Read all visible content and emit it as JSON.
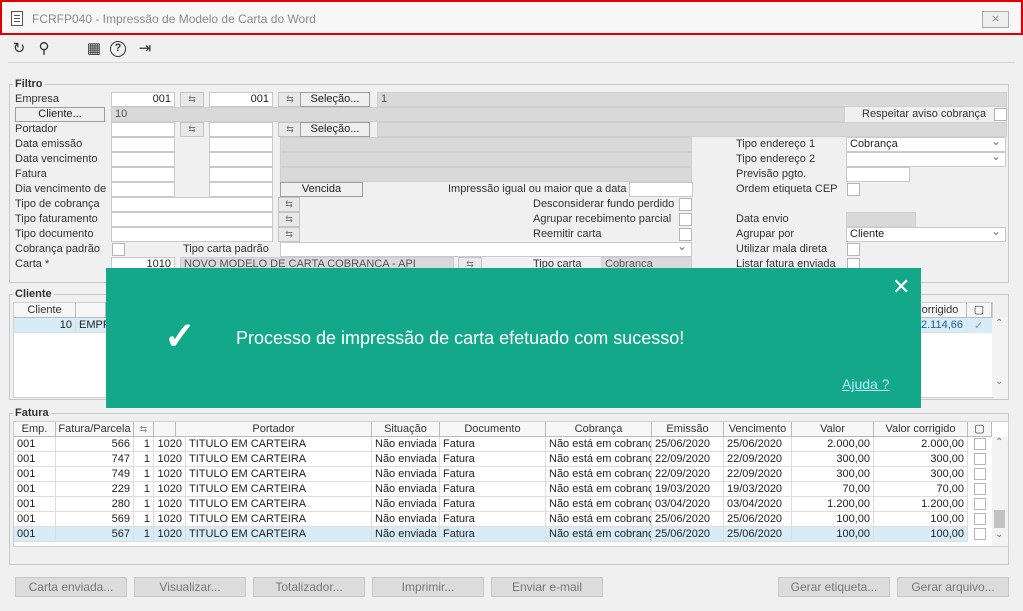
{
  "window": {
    "title": "FCRFP040 - Impressão de Modelo de Carta do Word",
    "close_glyph": "⨯"
  },
  "toolbar": {
    "refresh": "↻",
    "search": "⚲",
    "calendar": "▦",
    "help": "?",
    "exit": "⇥"
  },
  "filtro": {
    "legend": "Filtro",
    "empresa_label": "Empresa",
    "empresa_from": "001",
    "empresa_to": "001",
    "empresa_desc": "1",
    "selecao_label": "Seleção...",
    "cliente_btn": "Cliente...",
    "cliente_value": "10",
    "respeitar_label": "Respeitar aviso cobrança",
    "portador_label": "Portador",
    "data_emissao_label": "Data emissão",
    "data_vencimento_label": "Data vencimento",
    "fatura_label": "Fatura",
    "dia_venc_label": "Dia vencimento de",
    "vencida_btn": "Vencida",
    "impressao_label": "Impressão igual ou maior que a data",
    "tipo_cobranca_label": "Tipo de cobrança",
    "tipo_faturamento_label": "Tipo faturamento",
    "tipo_documento_label": "Tipo documento",
    "cobranca_padrao_label": "Cobrança padrão",
    "tipo_carta_padrao_label": "Tipo carta padrão",
    "carta_label": "Carta *",
    "carta_code": "1010",
    "carta_desc": "NOVO MODELO DE CARTA COBRANCA - API",
    "tipo_carta_label": "Tipo carta",
    "tipo_carta_value": "Cobranca",
    "desconsiderar_label": "Desconsiderar fundo perdido",
    "agrupar_receb_label": "Agrupar recebimento parcial",
    "reemitir_label": "Reemitir carta",
    "tipo_end1_label": "Tipo endereço 1",
    "tipo_end1_value": "Cobrança",
    "tipo_end2_label": "Tipo endereço 2",
    "previsao_label": "Previsão pgto.",
    "ordem_etiqueta_label": "Ordem etiqueta CEP",
    "data_envio_label": "Data envio",
    "agrupar_por_label": "Agrupar por",
    "agrupar_por_value": "Cliente",
    "mala_direta_label": "Utilizar mala direta",
    "listar_fatura_label": "Listar fatura enviada"
  },
  "cliente_section": {
    "legend": "Cliente",
    "col_cliente": "Cliente",
    "col_corrigido": "orrigido",
    "row_code": "10",
    "row_name": "EMPR",
    "row_value": "2.114,66"
  },
  "fatura_section": {
    "legend": "Fatura",
    "columns": [
      "Emp.",
      "Fatura/Parcela",
      "",
      "",
      "Portador",
      "Situação",
      "Documento",
      "Cobrança",
      "Emissão",
      "Vencimento",
      "Valor",
      "Valor corrigido"
    ],
    "rows": [
      {
        "emp": "001",
        "fatura": "566",
        "parc": "1",
        "port_code": "1020",
        "portador": "TITULO EM CARTEIRA",
        "situacao": "Não enviada",
        "documento": "Fatura",
        "cobranca": "Não está em cobrança",
        "emissao": "25/06/2020",
        "vencimento": "25/06/2020",
        "valor": "2.000,00",
        "corrigido": "2.000,00"
      },
      {
        "emp": "001",
        "fatura": "747",
        "parc": "1",
        "port_code": "1020",
        "portador": "TITULO EM CARTEIRA",
        "situacao": "Não enviada",
        "documento": "Fatura",
        "cobranca": "Não está em cobrança",
        "emissao": "22/09/2020",
        "vencimento": "22/09/2020",
        "valor": "300,00",
        "corrigido": "300,00"
      },
      {
        "emp": "001",
        "fatura": "749",
        "parc": "1",
        "port_code": "1020",
        "portador": "TITULO EM CARTEIRA",
        "situacao": "Não enviada",
        "documento": "Fatura",
        "cobranca": "Não está em cobrança",
        "emissao": "22/09/2020",
        "vencimento": "22/09/2020",
        "valor": "300,00",
        "corrigido": "300,00"
      },
      {
        "emp": "001",
        "fatura": "229",
        "parc": "1",
        "port_code": "1020",
        "portador": "TITULO EM CARTEIRA",
        "situacao": "Não enviada",
        "documento": "Fatura",
        "cobranca": "Não está em cobrança",
        "emissao": "19/03/2020",
        "vencimento": "19/03/2020",
        "valor": "70,00",
        "corrigido": "70,00"
      },
      {
        "emp": "001",
        "fatura": "280",
        "parc": "1",
        "port_code": "1020",
        "portador": "TITULO EM CARTEIRA",
        "situacao": "Não enviada",
        "documento": "Fatura",
        "cobranca": "Não está em cobrança",
        "emissao": "03/04/2020",
        "vencimento": "03/04/2020",
        "valor": "1.200,00",
        "corrigido": "1.200,00"
      },
      {
        "emp": "001",
        "fatura": "569",
        "parc": "1",
        "port_code": "1020",
        "portador": "TITULO EM CARTEIRA",
        "situacao": "Não enviada",
        "documento": "Fatura",
        "cobranca": "Não está em cobrança",
        "emissao": "25/06/2020",
        "vencimento": "25/06/2020",
        "valor": "100,00",
        "corrigido": "100,00"
      },
      {
        "emp": "001",
        "fatura": "567",
        "parc": "1",
        "port_code": "1020",
        "portador": "TITULO EM CARTEIRA",
        "situacao": "Não enviada",
        "documento": "Fatura",
        "cobranca": "Não está em cobrança",
        "emissao": "25/06/2020",
        "vencimento": "25/06/2020",
        "valor": "100,00",
        "corrigido": "100,00"
      }
    ]
  },
  "buttons": {
    "carta_enviada": "Carta enviada...",
    "visualizar": "Visualizar...",
    "totalizador": "Totalizador...",
    "imprimir": "Imprimir...",
    "enviar_email": "Enviar e-mail",
    "gerar_etiqueta": "Gerar etiqueta...",
    "gerar_arquivo": "Gerar arquivo..."
  },
  "dialog": {
    "message": "Processo de impressão de carta efetuado com sucesso!",
    "help_link": "Ajuda ?",
    "close": "✕",
    "check": "✓",
    "bg_color": "#13a88a"
  }
}
